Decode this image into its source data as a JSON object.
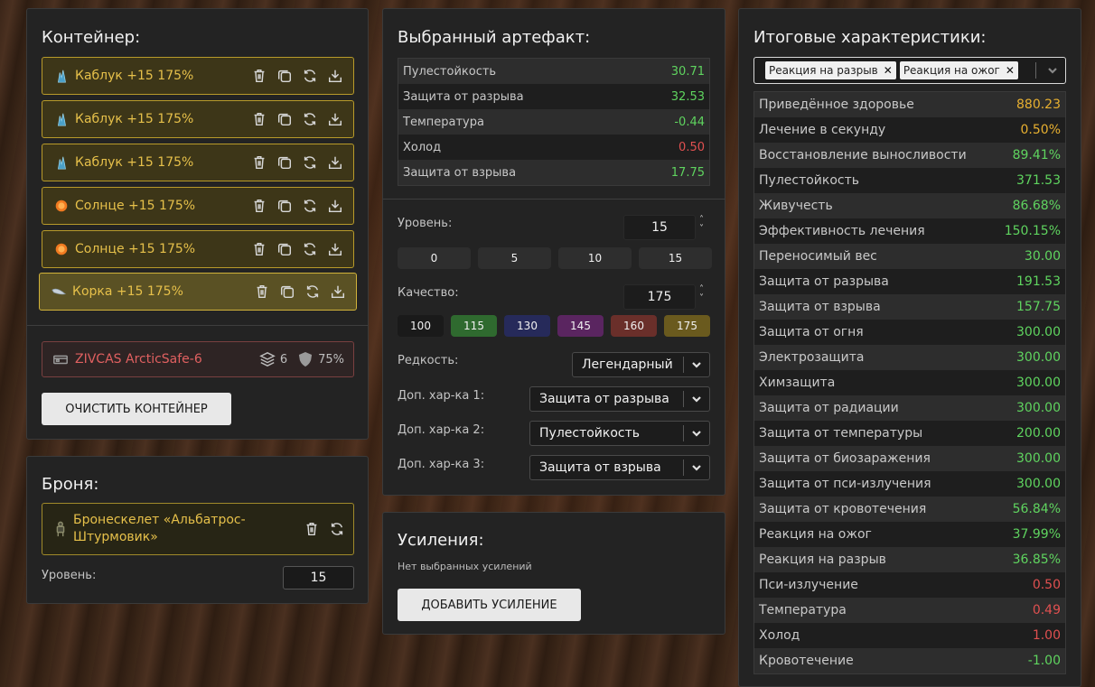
{
  "container": {
    "title": "Контейнер:",
    "items": [
      {
        "label": "Каблук +15 175%",
        "icon": "blue-crystal-icon"
      },
      {
        "label": "Каблук +15 175%",
        "icon": "blue-crystal-icon"
      },
      {
        "label": "Каблук +15 175%",
        "icon": "blue-crystal-icon"
      },
      {
        "label": "Солнце +15 175%",
        "icon": "orange-sun-icon"
      },
      {
        "label": "Солнце +15 175%",
        "icon": "orange-sun-icon"
      },
      {
        "label": "Корка +15 175%",
        "icon": "crust-icon"
      }
    ],
    "box": {
      "name": "ZIVCAS ArcticSafe-6",
      "slots": "6",
      "protection": "75%"
    },
    "clear_button": "Очистить контейнер"
  },
  "armor": {
    "title": "Броня:",
    "name": "Бронескелет «Альбатрос-Штурмовик»",
    "level_label": "Уровень:",
    "level_value": "15"
  },
  "artifact": {
    "title": "Выбранный артефакт:",
    "stats": [
      {
        "name": "Пулестойкость",
        "value": "30.71",
        "color": "#5fd45f"
      },
      {
        "name": "Защита от разрыва",
        "value": "32.53",
        "color": "#5fd45f"
      },
      {
        "name": "Температура",
        "value": "-0.44",
        "color": "#5fd45f"
      },
      {
        "name": "Холод",
        "value": "0.50",
        "color": "#e05050"
      },
      {
        "name": "Защита от взрыва",
        "value": "17.75",
        "color": "#5fd45f"
      }
    ],
    "level_label": "Уровень:",
    "level_value": "15",
    "level_presets": [
      "0",
      "5",
      "10",
      "15"
    ],
    "quality_label": "Качество:",
    "quality_value": "175",
    "quality_presets": [
      {
        "label": "100",
        "color": "#1a1a1a"
      },
      {
        "label": "115",
        "color": "#2f6a2f"
      },
      {
        "label": "130",
        "color": "#262a5a"
      },
      {
        "label": "145",
        "color": "#5a2560"
      },
      {
        "label": "160",
        "color": "#6a2f2a"
      },
      {
        "label": "175",
        "color": "#6a5a1e"
      }
    ],
    "rarity_label": "Редкость:",
    "rarity_value": "Легендарный",
    "extra1_label": "Доп. хар-ка 1:",
    "extra1_value": "Защита от разрыва",
    "extra2_label": "Доп. хар-ка 2:",
    "extra2_value": "Пулестойкость",
    "extra3_label": "Доп. хар-ка 3:",
    "extra3_value": "Защита от взрыва"
  },
  "boosts": {
    "title": "Усиления:",
    "empty_text": "Нет выбранных усилений",
    "add_button": "Добавить усиление"
  },
  "totals": {
    "title": "Итоговые характеристики:",
    "tags": [
      "Реакция на разрыв",
      "Реакция на ожог"
    ],
    "stats": [
      {
        "name": "Приведённое здоровье",
        "value": "880.23",
        "color": "#e8b030"
      },
      {
        "name": "Лечение в секунду",
        "value": "0.50%",
        "color": "#e8b030"
      },
      {
        "name": "Восстановление выносливости",
        "value": "89.41%",
        "color": "#5fd45f"
      },
      {
        "name": "Пулестойкость",
        "value": "371.53",
        "color": "#5fd45f"
      },
      {
        "name": "Живучесть",
        "value": "86.68%",
        "color": "#5fd45f"
      },
      {
        "name": "Эффективность лечения",
        "value": "150.15%",
        "color": "#5fd45f"
      },
      {
        "name": "Переносимый вес",
        "value": "30.00",
        "color": "#5fd45f"
      },
      {
        "name": "Защита от разрыва",
        "value": "191.53",
        "color": "#5fd45f"
      },
      {
        "name": "Защита от взрыва",
        "value": "157.75",
        "color": "#5fd45f"
      },
      {
        "name": "Защита от огня",
        "value": "300.00",
        "color": "#5fd45f"
      },
      {
        "name": "Электрозащита",
        "value": "300.00",
        "color": "#5fd45f"
      },
      {
        "name": "Химзащита",
        "value": "300.00",
        "color": "#5fd45f"
      },
      {
        "name": "Защита от радиации",
        "value": "300.00",
        "color": "#5fd45f"
      },
      {
        "name": "Защита от температуры",
        "value": "200.00",
        "color": "#5fd45f"
      },
      {
        "name": "Защита от биозаражения",
        "value": "300.00",
        "color": "#5fd45f"
      },
      {
        "name": "Защита от пси-излучения",
        "value": "300.00",
        "color": "#5fd45f"
      },
      {
        "name": "Защита от кровотечения",
        "value": "56.84%",
        "color": "#5fd45f"
      },
      {
        "name": "Реакция на ожог",
        "value": "37.99%",
        "color": "#5fd45f"
      },
      {
        "name": "Реакция на разрыв",
        "value": "36.85%",
        "color": "#5fd45f"
      },
      {
        "name": "Пси-излучение",
        "value": "0.50",
        "color": "#e05050"
      },
      {
        "name": "Температура",
        "value": "0.49",
        "color": "#e05050"
      },
      {
        "name": "Холод",
        "value": "1.00",
        "color": "#e05050"
      },
      {
        "name": "Кровотечение",
        "value": "-1.00",
        "color": "#5fd45f"
      }
    ]
  }
}
